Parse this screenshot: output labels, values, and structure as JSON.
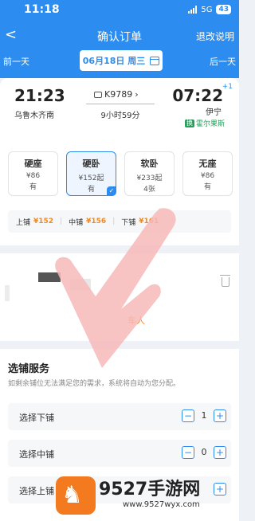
{
  "status": {
    "time": "11:18",
    "network": "5G",
    "battery": "43"
  },
  "nav": {
    "back": "<",
    "title": "确认订单",
    "change_link": "退改说明"
  },
  "date_bar": {
    "prev": "前一天",
    "date": "06月18日 周三",
    "next": "后一天"
  },
  "trip": {
    "departure_time": "21:23",
    "departure_station": "乌鲁木齐南",
    "train_no": "K9789",
    "duration": "9小时59分",
    "arrival_time": "07:22",
    "arrival_day_offset": "+1",
    "arrival_station": "伊宁",
    "arrival_tag": "霍尔果斯",
    "arrival_tag_badge": "换"
  },
  "seats": [
    {
      "name": "硬座",
      "price": "¥86",
      "stock": "有",
      "selected": false
    },
    {
      "name": "硬卧",
      "price": "¥152起",
      "stock": "有",
      "selected": true
    },
    {
      "name": "软卧",
      "price": "¥233起",
      "stock": "4张",
      "selected": false
    },
    {
      "name": "无座",
      "price": "¥86",
      "stock": "有",
      "selected": false
    }
  ],
  "berths": [
    {
      "label": "上铺",
      "price": "¥152"
    },
    {
      "label": "中铺",
      "price": "¥156"
    },
    {
      "label": "下铺",
      "price": "¥161"
    }
  ],
  "passenger": {
    "add_label": "车人"
  },
  "service": {
    "title": "选铺服务",
    "note": "如剩余铺位无法满足您的需求，系统将自动为您分配。",
    "options": [
      {
        "label": "选择下铺",
        "qty": "1"
      },
      {
        "label": "选择中铺",
        "qty": "0"
      },
      {
        "label": "选择上铺",
        "qty": ""
      }
    ],
    "minus": "−",
    "plus": "+"
  },
  "watermark": {
    "logo_glyph": "♞",
    "title": "9527手游网",
    "url": "www.9527wyx.com"
  },
  "colors": {
    "primary": "#2d8cf0",
    "price": "#f08a24",
    "overlay_arrow": "#f6b9b9"
  }
}
